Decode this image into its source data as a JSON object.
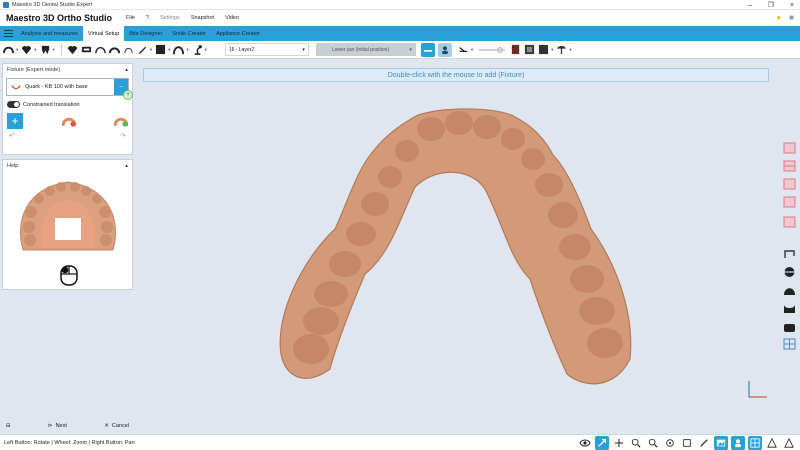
{
  "window": {
    "title": "Maestro 3D Dental Studio Expert",
    "controls": [
      "–",
      "❐",
      "×"
    ]
  },
  "menubar": {
    "brand": "Maestro 3D Ortho Studio",
    "items": [
      "File",
      "?",
      "Settings",
      "Snapshot",
      "Video"
    ]
  },
  "tabs": [
    "Analysis and measures",
    "Virtual Setup",
    "Bite Designer",
    "Smile Creator",
    "Appliance Creator"
  ],
  "active_tab": "Virtual Setup",
  "toolbar": {
    "layer": "16 - Layer2",
    "jaw": "Lower jaw (initial position)"
  },
  "fixture_panel": {
    "title": "Fixture (Expert mode)",
    "selected": "Quark - KB 100 with base",
    "constrained_label": "Constrained translation"
  },
  "help_panel": {
    "title": "Help"
  },
  "bottom": {
    "next": "Next",
    "cancel": "Cancel"
  },
  "viewport": {
    "hint": "Double-click with the mouse to add  (Fixture)"
  },
  "status": {
    "text": "Left Button: Rotate | Wheel: Zoom | Right Button: Pan"
  },
  "colors": {
    "accent": "#29a0d8",
    "model": "#d39a78"
  }
}
